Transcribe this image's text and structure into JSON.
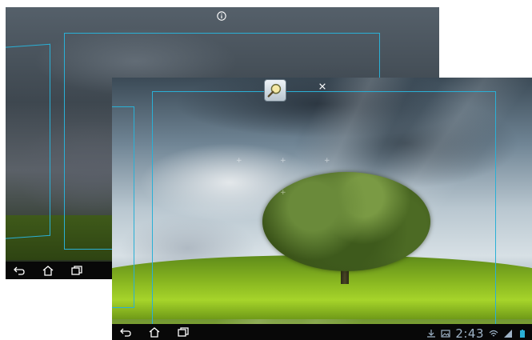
{
  "back_screen": {
    "info_icon": "info-icon",
    "nav": {
      "back": "back-icon",
      "home": "home-icon",
      "recent": "recent-apps-icon"
    }
  },
  "front_screen": {
    "close_icon": "close-icon",
    "widget_icon": "zoom-magnifier-icon",
    "nav": {
      "back": "back-icon",
      "home": "home-icon",
      "recent": "recent-apps-icon"
    },
    "status": {
      "time": "2:43",
      "icons": [
        "download-icon",
        "gallery-icon",
        "wifi-icon",
        "signal-icon",
        "battery-icon"
      ]
    }
  },
  "colors": {
    "frame": "#2ab0d6",
    "navbar": "#080808",
    "clock": "#9fb4c8"
  }
}
